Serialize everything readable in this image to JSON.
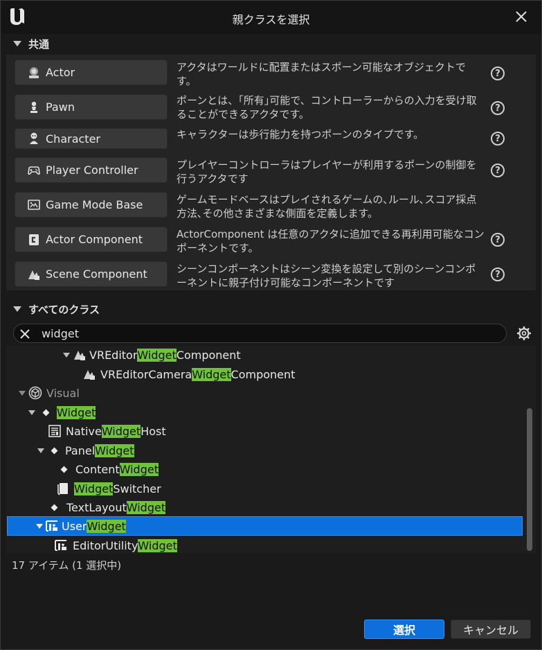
{
  "window": {
    "title": "親クラスを選択"
  },
  "common": {
    "header": "共通",
    "items": [
      {
        "label": "Actor",
        "icon": "actor-icon",
        "desc": "アクタはワールドに配置またはスポーン可能なオブジェクトです。"
      },
      {
        "label": "Pawn",
        "icon": "pawn-icon",
        "desc": "ポーンとは、｢所有｣可能で、コントローラーからの入力を受け取ることができるアクタです。"
      },
      {
        "label": "Character",
        "icon": "character-icon",
        "desc": "キャラクターは歩行能力を持つポーンのタイプです。"
      },
      {
        "label": "Player Controller",
        "icon": "gamepad-icon",
        "desc": "プレイヤーコントローラはプレイヤーが利用するポーンの制御を行うアクタです"
      },
      {
        "label": "Game Mode Base",
        "icon": "game-mode-icon",
        "desc": "ゲームモードベースはプレイされるゲームの､ルール､スコア採点方法､その他さまざまな側面を定義します。"
      },
      {
        "label": "Actor Component",
        "icon": "actor-component-icon",
        "desc": "ActorComponent は任意のアクタに追加できる再利用可能なコンポーネントです。"
      },
      {
        "label": "Scene Component",
        "icon": "scene-component-icon",
        "desc": "シーンコンポーネントはシーン変換を設定して別のシーンコンポーネントに親子付け可能なコンポーネントです"
      }
    ],
    "help_glyph": "?"
  },
  "all_classes": {
    "header": "すべてのクラス",
    "search_value": "widget"
  },
  "tree": {
    "rows": [
      {
        "pre": "VREditor",
        "hl": "Widget",
        "post": "Component"
      },
      {
        "pre": "VREditorCamera",
        "hl": "Widget",
        "post": "Component"
      },
      {
        "pre": "Visual",
        "hl": "",
        "post": ""
      },
      {
        "pre": "",
        "hl": "Widget",
        "post": ""
      },
      {
        "pre": "Native",
        "hl": "Widget",
        "post": "Host"
      },
      {
        "pre": "Panel",
        "hl": "Widget",
        "post": ""
      },
      {
        "pre": "Content",
        "hl": "Widget",
        "post": ""
      },
      {
        "pre": "",
        "hl": "Widget",
        "post": "Switcher"
      },
      {
        "pre": "TextLayout",
        "hl": "Widget",
        "post": ""
      },
      {
        "pre": "User",
        "hl": "Widget",
        "post": ""
      },
      {
        "pre": "EditorUtility",
        "hl": "Widget",
        "post": ""
      }
    ]
  },
  "status": "17 アイテム (1 選択中)",
  "buttons": {
    "select": "選択",
    "cancel": "キャンセル"
  },
  "colors": {
    "accent": "#0d6fdb",
    "highlight": "#6fc339"
  }
}
